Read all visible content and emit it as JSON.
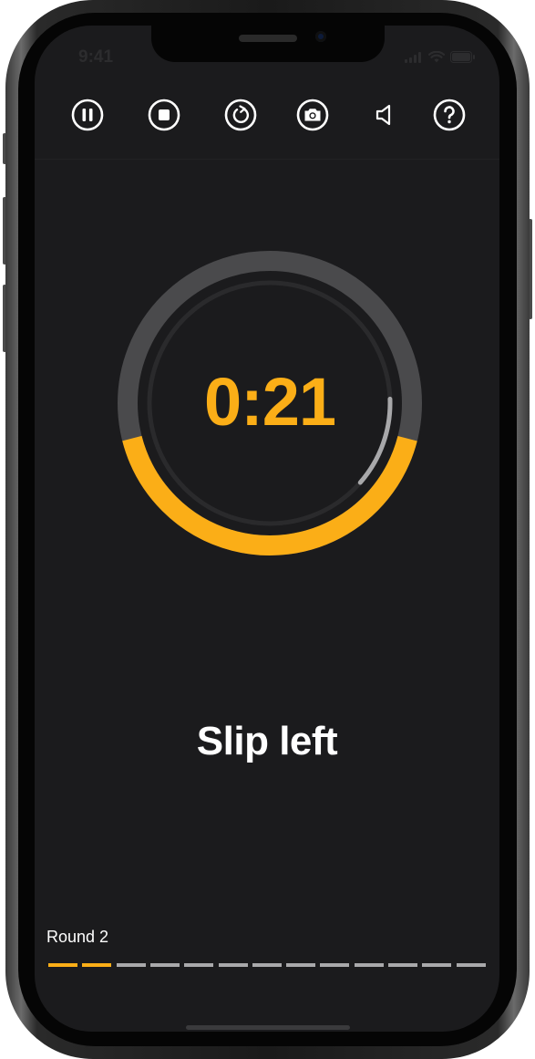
{
  "status_bar": {
    "time": "9:41"
  },
  "toolbar": {
    "items": [
      {
        "name": "pause-button",
        "icon": "pause-icon"
      },
      {
        "name": "stop-button",
        "icon": "stop-icon"
      },
      {
        "name": "restart-button",
        "icon": "restart-icon"
      },
      {
        "name": "camera-button",
        "icon": "camera-icon"
      },
      {
        "name": "sound-button",
        "icon": "speaker-icon"
      },
      {
        "name": "help-button",
        "icon": "help-icon"
      }
    ]
  },
  "timer": {
    "display": "0:21",
    "outer_progress": 0.42,
    "inner_progress": 0.12
  },
  "exercise": {
    "name": "Slip left"
  },
  "round": {
    "label": "Round 2",
    "current": 2,
    "total": 13
  },
  "colors": {
    "accent": "#fbae17",
    "background": "#1b1b1d",
    "track": "#4a4a4c",
    "inner_track": "#2a2a2c",
    "inner_progress": "#a8a8aa",
    "segment_inactive": "#a9a9ab",
    "text": "#ffffff"
  }
}
